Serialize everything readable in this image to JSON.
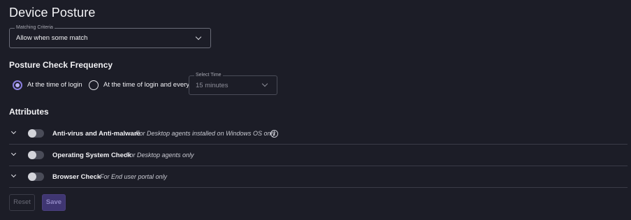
{
  "page": {
    "title": "Device Posture"
  },
  "matching": {
    "label": "Matching Criteria",
    "value": "Allow when some match",
    "icon": "chevron-down-icon"
  },
  "frequency": {
    "title": "Posture Check Frequency",
    "options": [
      {
        "label": "At the time of login",
        "checked": true
      },
      {
        "label": "At the time of login and every",
        "checked": false
      }
    ],
    "select": {
      "label": "Select Time",
      "value": "15 minutes",
      "disabled": true
    }
  },
  "attributes": {
    "title": "Attributes",
    "items": [
      {
        "name": "Anti-virus and Anti-malware",
        "description": "For Desktop agents installed on Windows OS only",
        "enabled": false,
        "info_icon": "info-icon"
      },
      {
        "name": "Operating System Check",
        "description": "For Desktop agents only",
        "enabled": false
      },
      {
        "name": "Browser Check",
        "description": "For End user portal only",
        "enabled": false
      }
    ]
  },
  "actions": {
    "reset_label": "Reset",
    "save_label": "Save"
  },
  "colors": {
    "background": "#1c1d27",
    "accent": "#8b7fe0",
    "save_button": "#3f3672"
  }
}
